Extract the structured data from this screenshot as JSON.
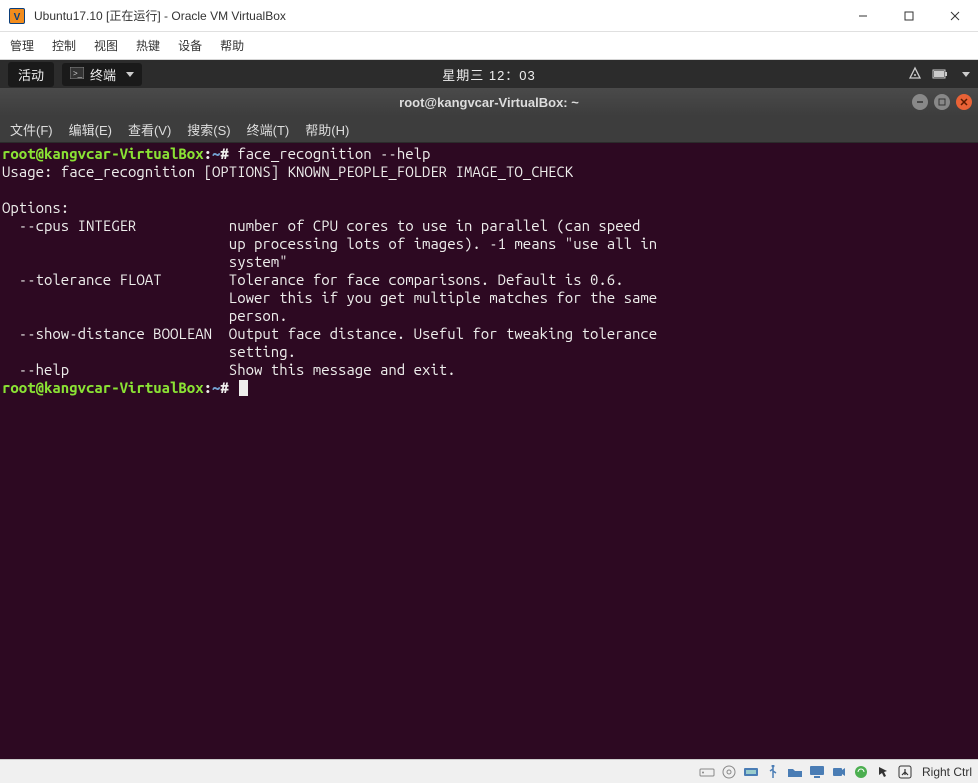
{
  "vbox": {
    "title": "Ubuntu17.10 [正在运行] - Oracle VM VirtualBox",
    "menus": [
      "管理",
      "控制",
      "视图",
      "热键",
      "设备",
      "帮助"
    ],
    "status_key_label": "Right Ctrl"
  },
  "ubuntu": {
    "activities": "活动",
    "app_name": "终端",
    "time_label": "星期三 12：03"
  },
  "terminal": {
    "title": "root@kangvcar-VirtualBox: ~",
    "menus": [
      "文件(F)",
      "编辑(E)",
      "查看(V)",
      "搜索(S)",
      "终端(T)",
      "帮助(H)"
    ],
    "prompt_user": "root@kangvcar-VirtualBox",
    "prompt_colon": ":",
    "prompt_path": "~",
    "prompt_symbol": "#",
    "command": "face_recognition --help",
    "output_lines": [
      "Usage: face_recognition [OPTIONS] KNOWN_PEOPLE_FOLDER IMAGE_TO_CHECK",
      "",
      "Options:",
      "  --cpus INTEGER           number of CPU cores to use in parallel (can speed",
      "                           up processing lots of images). -1 means \"use all in",
      "                           system\"",
      "  --tolerance FLOAT        Tolerance for face comparisons. Default is 0.6.",
      "                           Lower this if you get multiple matches for the same",
      "                           person.",
      "  --show-distance BOOLEAN  Output face distance. Useful for tweaking tolerance",
      "                           setting.",
      "  --help                   Show this message and exit."
    ]
  }
}
